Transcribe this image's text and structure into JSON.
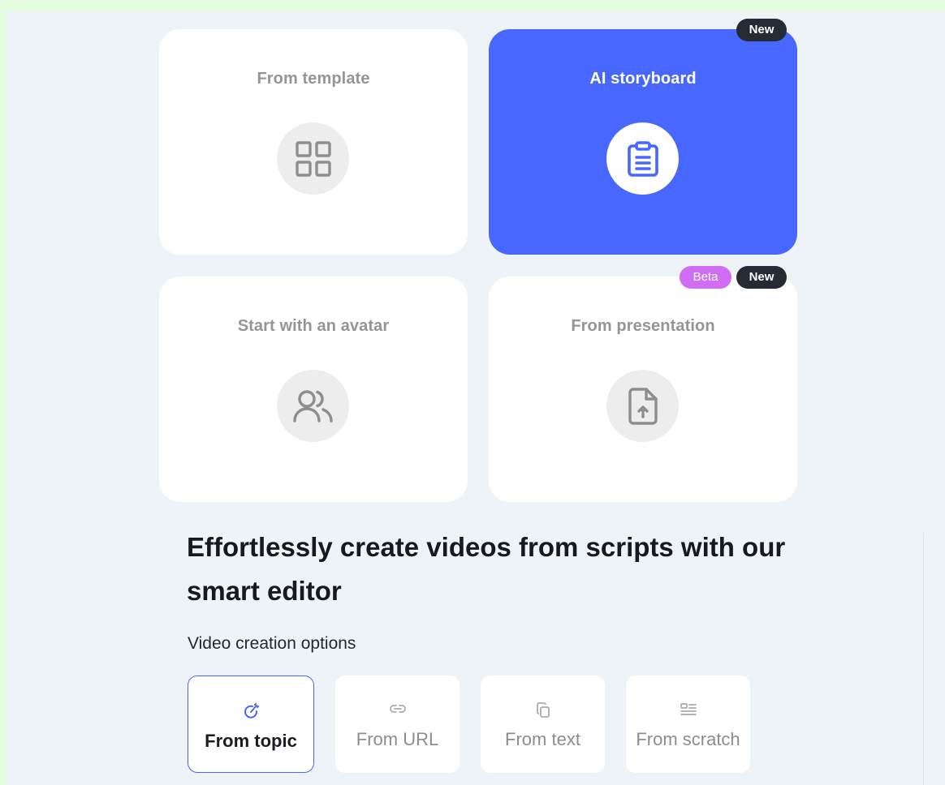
{
  "cards": [
    {
      "title": "From template",
      "icon": "grid-icon",
      "active": false
    },
    {
      "title": "AI storyboard",
      "icon": "clipboard-icon",
      "active": true
    },
    {
      "title": "Start with an avatar",
      "icon": "users-icon",
      "active": false
    },
    {
      "title": "From presentation",
      "icon": "file-upload-icon",
      "active": false
    }
  ],
  "badges": {
    "storyboard_new": "New",
    "presentation_beta": "Beta",
    "presentation_new": "New"
  },
  "headline": "Effortlessly create videos from scripts with our smart editor",
  "options_label": "Video creation options",
  "options": [
    {
      "label": "From topic",
      "icon": "sparkle-pen-icon",
      "selected": true
    },
    {
      "label": "From URL",
      "icon": "link-icon",
      "selected": false
    },
    {
      "label": "From text",
      "icon": "copy-icon",
      "selected": false
    },
    {
      "label": "From scratch",
      "icon": "layout-lines-icon",
      "selected": false
    }
  ],
  "colors": {
    "accent": "#4767ff",
    "card": "#ffffff",
    "background": "#eef3f8",
    "badge_dark": "#252a33",
    "badge_beta": "#cf6ef2"
  }
}
